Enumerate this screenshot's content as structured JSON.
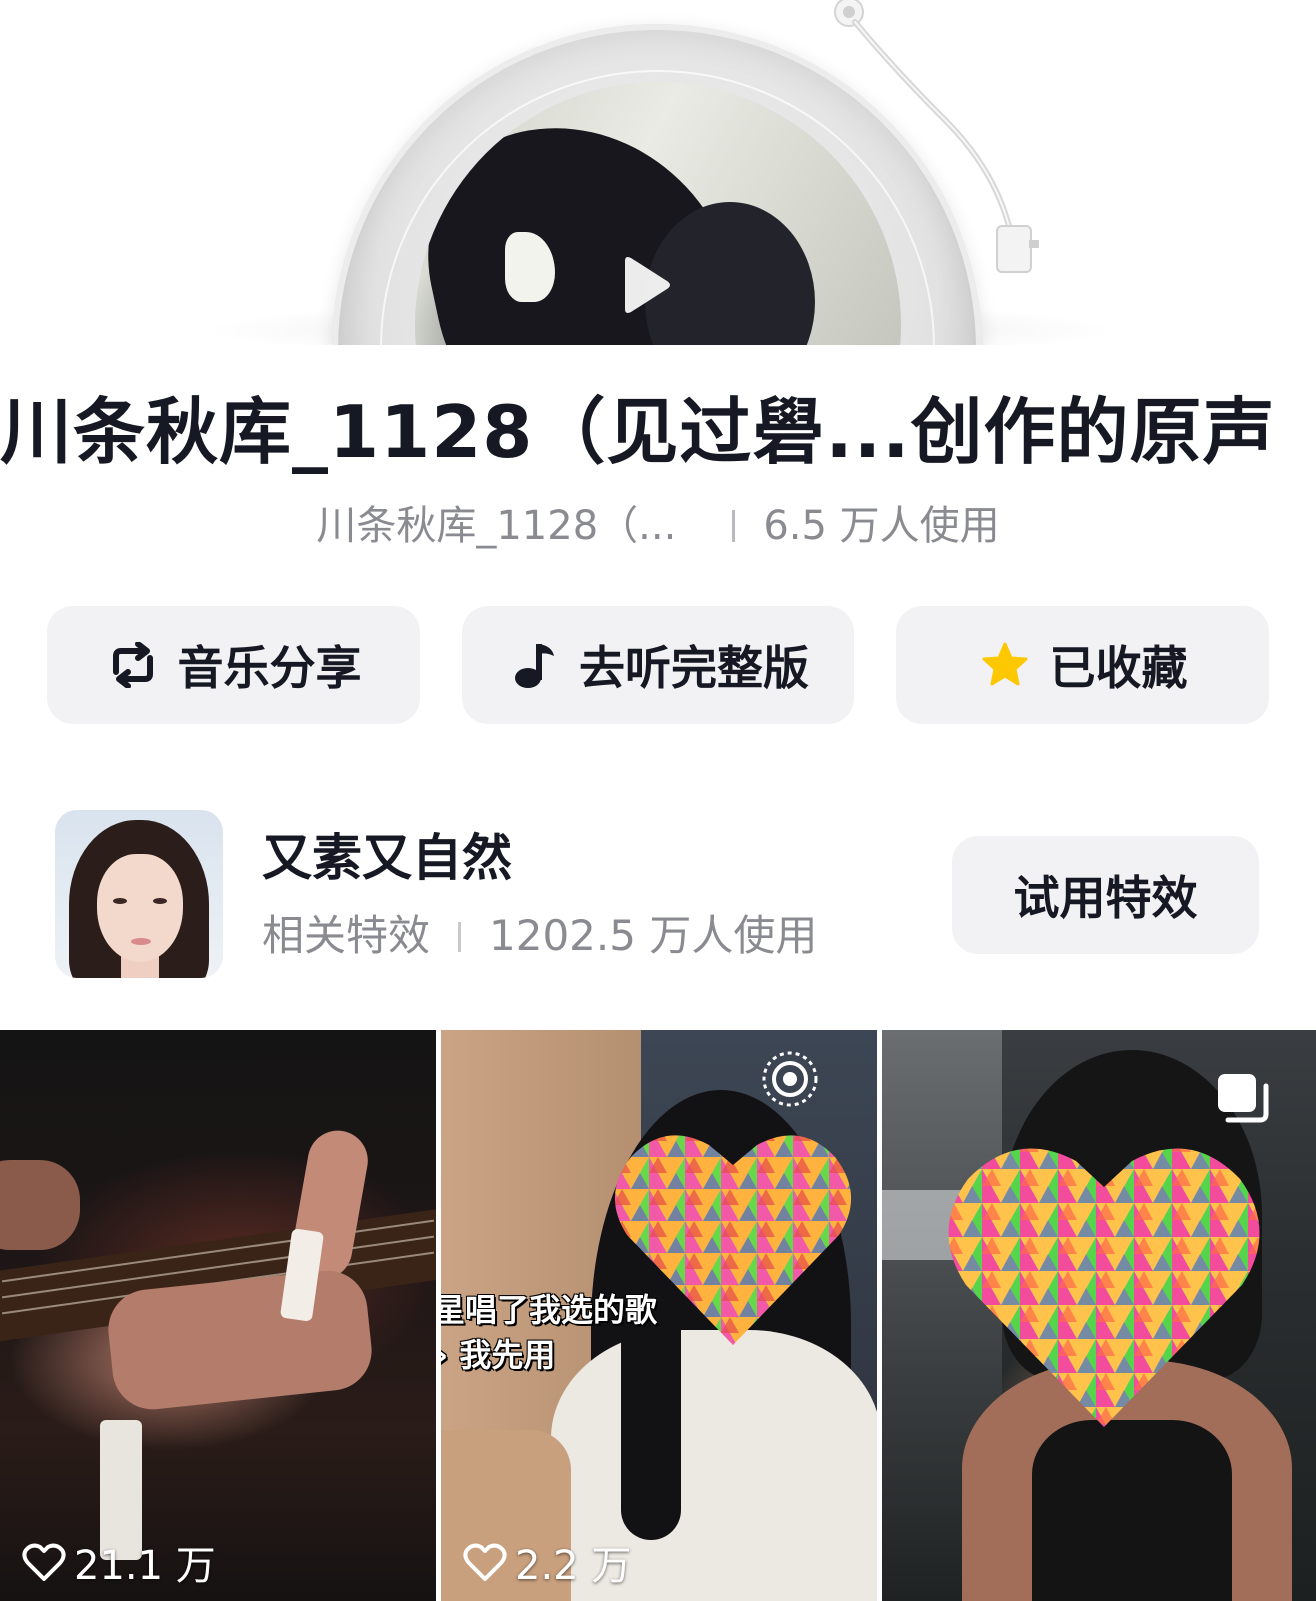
{
  "music": {
    "title": "川条秋库_1128（见过礐...创作的原声",
    "author": "川条秋库_1128（...",
    "usage": "6.5 万人使用"
  },
  "actions": {
    "share_label": "音乐分享",
    "full_label": "去听完整版",
    "favorite_label": "已收藏"
  },
  "effect": {
    "name": "又素又自然",
    "type_label": "相关特效",
    "usage": "1202.5 万人使用",
    "try_label": "试用特效"
  },
  "videos": [
    {
      "likes": "21.1 万"
    },
    {
      "likes": "2.2 万",
      "caption_line1": "星唱了我选的歌",
      "caption_line2": "› 我先用"
    },
    {
      "likes": ""
    }
  ],
  "colors": {
    "text_primary": "#161823",
    "text_secondary": "#8a8b91",
    "button_bg": "#f2f2f4",
    "star": "#fdc800"
  },
  "icons": {
    "share": "repost-arrows-icon",
    "full": "music-note-icon",
    "favorite": "star-icon",
    "play": "play-icon",
    "likes": "heart-outline-icon",
    "live": "live-broadcast-icon",
    "gallery": "photo-stack-icon"
  }
}
